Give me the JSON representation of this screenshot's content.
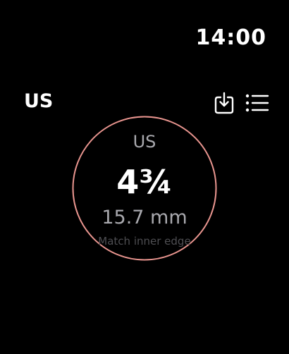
{
  "status_bar": {
    "time": "14:00"
  },
  "nav": {
    "title": "US",
    "actions": [
      {
        "icon": "save-to-device-icon"
      },
      {
        "icon": "list-icon"
      }
    ]
  },
  "ring_display": {
    "system": "US",
    "size": "4¾",
    "diameter": "15.7 mm",
    "hint": "Match inner edge",
    "ring_color": "#e9958f"
  },
  "colors": {
    "background": "#000000",
    "primary_text": "#ffffff",
    "secondary_text": "#a9a9ae",
    "hint_text": "#4e4e52",
    "accent": "#e9958f"
  }
}
